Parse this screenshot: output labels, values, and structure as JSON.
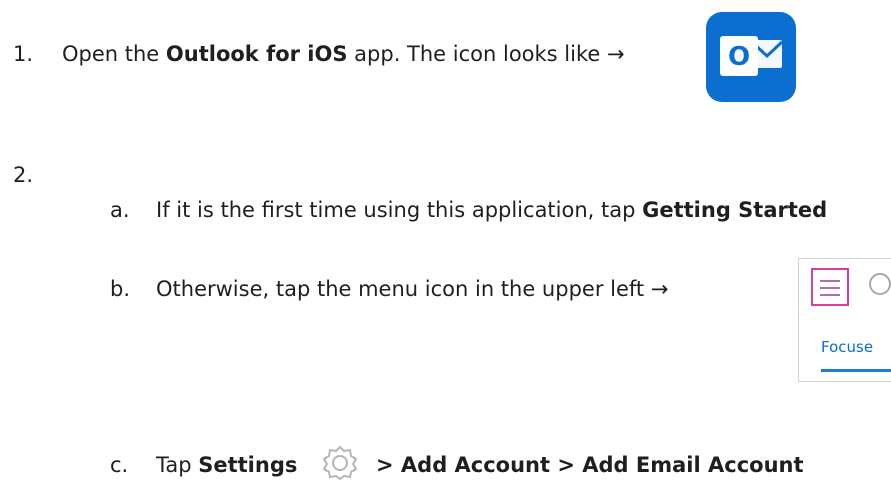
{
  "steps": {
    "one": {
      "number": "1.",
      "text_before": "Open the ",
      "bold": "Outlook for iOS",
      "text_after": " app. The icon looks like →",
      "icon_letter": "O"
    },
    "two": {
      "number": "2."
    },
    "a": {
      "marker": "a.",
      "text_before": "If it is the first time using this application, tap ",
      "bold": "Getting Started"
    },
    "b": {
      "marker": "b.",
      "text": "Otherwise, tap the menu icon in the upper left →",
      "focus_tab_label": "Focuse"
    },
    "c": {
      "marker": "c.",
      "text_before": "Tap ",
      "bold1": "Settings",
      "bold2": "> Add Account > Add Email Account"
    }
  },
  "colors": {
    "outlook_blue": "#0a6fd1",
    "menu_highlight": "#d63fa0",
    "focus_blue": "#0b6ec8"
  }
}
